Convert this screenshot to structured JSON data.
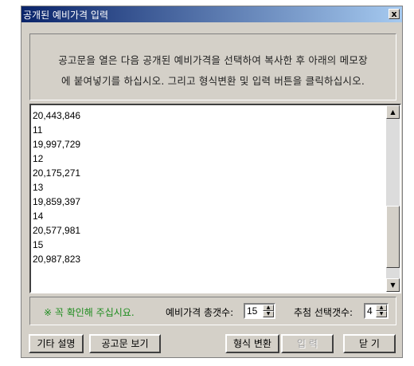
{
  "window": {
    "title": "공개된 예비가격 입력",
    "close_label": "x"
  },
  "instructions": {
    "line1": "공고문을 열은 다음 공개된 예비가격을 선택하여 복사한 후  아래의 메모장",
    "line2": "에 붙여넣기를 하십시오.  그리고 형식변환 및 입력 버튼을 클릭하십시오."
  },
  "memo": {
    "lines": [
      "20,443,846",
      "11",
      "19,997,729",
      "12",
      "20,175,271",
      "13",
      "19,859,397",
      "14",
      "20,577,981",
      "15",
      "20,987,823"
    ]
  },
  "settings": {
    "notice": "※ 꼭 확인해 주십시요.",
    "total_label": "예비가격 총갯수:",
    "total_value": "15",
    "select_label": "추첨 선택갯수:",
    "select_value": "4"
  },
  "buttons": {
    "other_help": "기타 설명",
    "view_notice": "공고문 보기",
    "convert": "형식 변환",
    "input": "입 력",
    "close": "닫 기"
  }
}
